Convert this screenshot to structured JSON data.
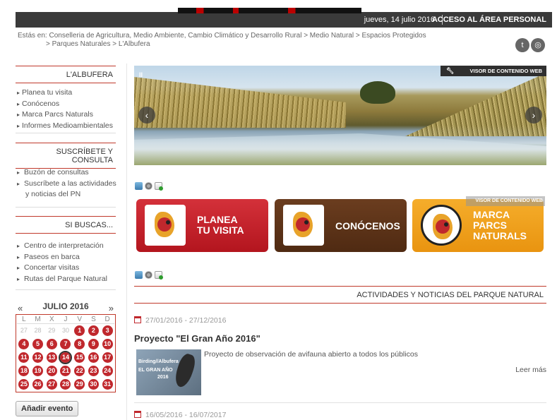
{
  "topbar": {
    "date": "jueves, 14 julio 2016",
    "access": "ACCESO AL ÁREA PERSONAL"
  },
  "breadcrumb": {
    "prefix": "Estás en:",
    "line1": "Conselleria de Agricultura, Medio Ambiente, Cambio Climático y Desarrollo Rural  >  Medio Natural  >  Espacios Protegidos",
    "line2": ">  Parques Naturales  >  L'Albufera"
  },
  "sidebar": {
    "section1": {
      "title": "L'ALBUFERA",
      "items": [
        "Planea tu visita",
        "Conócenos",
        "Marca Parcs Naturals",
        "Informes Medioambientales"
      ]
    },
    "section2": {
      "title": "SUSCRÍBETE Y CONSULTA",
      "items": [
        "Buzón de consultas",
        "Suscríbete a las actividades y noticias del PN"
      ]
    },
    "section3": {
      "title": "SI BUSCAS...",
      "items": [
        "Centro de interpretación",
        "Paseos en barca",
        "Concertar visitas",
        "Rutas del Parque Natural"
      ]
    }
  },
  "calendar": {
    "title": "JULIO 2016",
    "prev": "«",
    "next": "»",
    "weekdays": [
      "L",
      "M",
      "X",
      "J",
      "V",
      "S",
      "D"
    ],
    "prev_days": [
      "27",
      "28",
      "29",
      "30"
    ],
    "days": [
      "1",
      "2",
      "3",
      "4",
      "5",
      "6",
      "7",
      "8",
      "9",
      "10",
      "11",
      "12",
      "13",
      "14",
      "15",
      "16",
      "17",
      "18",
      "19",
      "20",
      "21",
      "22",
      "23",
      "24",
      "25",
      "26",
      "27",
      "28",
      "29",
      "30",
      "31"
    ],
    "today": "14",
    "add_event": "Añadir evento"
  },
  "slider": {
    "pause": "II",
    "prev": "‹",
    "next": "›",
    "visor": "VISOR DE CONTENIDO WEB"
  },
  "buttons": {
    "plan": [
      "PLANEA",
      "TU VISITA"
    ],
    "know": "CONÓCENOS",
    "brand": [
      "MARCA",
      "PARCS",
      "NATURALS"
    ],
    "visor": "VISOR DE CONTENIDO WEB"
  },
  "news": {
    "header": "ACTIVIDADES Y NOTICIAS DEL PARQUE NATURAL",
    "item1": {
      "date": "27/01/2016 - 27/12/2016",
      "title": "Proyecto \"El Gran Año 2016\"",
      "thumb_line1": "Birding//Albufera",
      "thumb_line2": "EL GRAN AÑO",
      "thumb_line3": "2016",
      "desc": "Proyecto de observación de avifauna abierto a todos los públicos",
      "more": "Leer más"
    },
    "item2": {
      "date": "16/05/2016 - 16/07/2017"
    }
  },
  "colors": {
    "accent": "#c0282d",
    "brown": "#5a3217",
    "orange": "#f0a11e",
    "topbar": "#3a3a3a"
  }
}
